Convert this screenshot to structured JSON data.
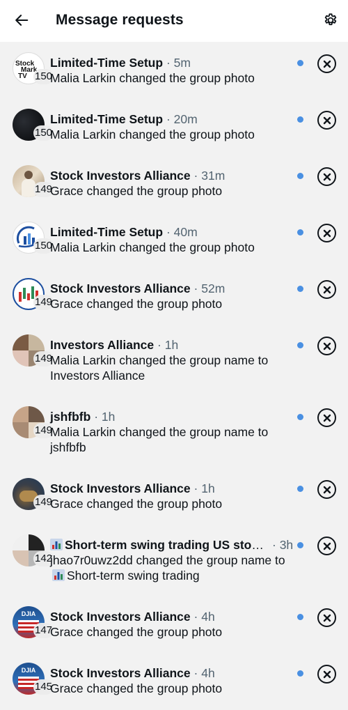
{
  "header": {
    "title": "Message requests",
    "back_icon": "arrow-left-icon",
    "settings_icon": "gear-icon"
  },
  "colors": {
    "unread_dot": "#4a90e2",
    "text_primary": "#0f1419",
    "text_secondary": "#536471",
    "background": "#f2f2f2"
  },
  "requests": [
    {
      "name": "Limited-Time Setup",
      "sep": "·",
      "time": "5m",
      "count": "150",
      "message": "Malia Larkin changed the group photo",
      "avatar": "stockmarket-tv-logo"
    },
    {
      "name": "Limited-Time Setup",
      "sep": "·",
      "time": "20m",
      "count": "150",
      "message": "Malia Larkin changed the group photo",
      "avatar": "dark-chart-photo"
    },
    {
      "name": "Stock Investors Alliance",
      "sep": "·",
      "time": "31m",
      "count": "149",
      "message": "Grace changed the group photo",
      "avatar": "person-photo"
    },
    {
      "name": "Limited-Time Setup",
      "sep": "·",
      "time": "40m",
      "count": "150",
      "message": "Malia Larkin changed the group photo",
      "avatar": "chart-logo"
    },
    {
      "name": "Stock Investors Alliance",
      "sep": "·",
      "time": "52m",
      "count": "149",
      "message": "Grace changed the group photo",
      "avatar": "candlestick-logo"
    },
    {
      "name": "Investors Alliance",
      "sep": "·",
      "time": "1h",
      "count": "149",
      "message": "Malia Larkin changed the group name to Investors Alliance",
      "avatar": "group-collage"
    },
    {
      "name": "jshfbfb",
      "sep": "·",
      "time": "1h",
      "count": "149",
      "message": "Malia Larkin changed the group name to jshfbfb",
      "avatar": "group-collage"
    },
    {
      "name": "Stock Investors Alliance",
      "sep": "·",
      "time": "1h",
      "count": "149",
      "message": "Grace changed the group photo",
      "avatar": "bull-photo"
    },
    {
      "name": "Short-term swing trading US stoc...",
      "sep": "·",
      "time": "3h",
      "count": "142",
      "message": "jhao7r0uwz2dd changed the group name to",
      "message_tail": "Short-term swing trading",
      "avatar": "group-collage-2",
      "chart_emoji": "bar-chart-icon"
    },
    {
      "name": "Stock Investors Alliance",
      "sep": "·",
      "time": "4h",
      "count": "147",
      "message": "Grace changed the group photo",
      "avatar": "djia-logo",
      "avatar_text": "DJIA"
    },
    {
      "name": "Stock Investors Alliance",
      "sep": "·",
      "time": "4h",
      "count": "145",
      "message": "Grace changed the group photo",
      "avatar": "djia-logo",
      "avatar_text": "DJIA"
    }
  ],
  "avatar_text": {
    "stockmarket": [
      "Stock",
      "Mark",
      "TV"
    ]
  }
}
